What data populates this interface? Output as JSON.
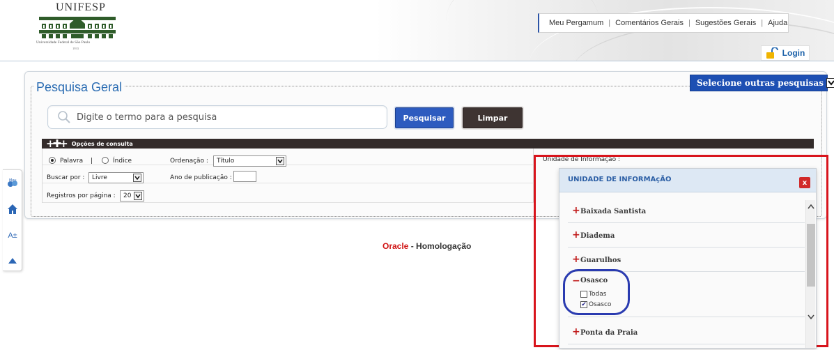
{
  "header": {
    "logo_name": "UNIFESP",
    "logo_university": "Universidade Federal de São Paulo",
    "logo_year": "1933",
    "links": [
      "Meu Pergamum",
      "Comentários Gerais",
      "Sugestões Gerais",
      "Ajuda"
    ],
    "login_label": "Login"
  },
  "main": {
    "title": "Pesquisa Geral",
    "other_searches_label": "Selecione outras pesquisas",
    "search_placeholder": "Digite o termo para a pesquisa",
    "search_button": "Pesquisar",
    "clear_button": "Limpar",
    "options_bar_label": "Opções de consulta",
    "options": {
      "radio_word": "Palavra",
      "radio_separator": "|",
      "radio_index": "Índice",
      "ordering_label": "Ordenação :",
      "ordering_value": "Título",
      "search_by_label": "Buscar por :",
      "search_by_value": "Livre",
      "year_label": "Ano de publicação :",
      "per_page_label": "Registros por página :",
      "per_page_value": "20"
    },
    "unit_label": "Unidade de Informação :"
  },
  "side_toolbar": {
    "items": [
      "meu-pergamum-icon",
      "home-icon",
      "font-size-icon",
      "scroll-top-icon"
    ],
    "font_size_text": "A±"
  },
  "footer": {
    "oracle_red": "Oracle",
    "oracle_rest": " - Homologação"
  },
  "popup": {
    "title": "UNIDADE DE INFORMAçÃO",
    "close_label": "x",
    "units": [
      {
        "name": "Baixada Santista",
        "expanded": false
      },
      {
        "name": "Diadema",
        "expanded": false
      },
      {
        "name": "Guarulhos",
        "expanded": false
      },
      {
        "name": "Osasco",
        "expanded": true
      },
      {
        "name": "Ponta da Praia",
        "expanded": false
      }
    ],
    "osasco_items": [
      {
        "label": "Todas",
        "checked": false
      },
      {
        "label": "Osasco",
        "checked": true
      }
    ]
  },
  "colors": {
    "brand_blue": "#2c6db3",
    "search_button": "#2d5bbf",
    "clear_button": "#3e3432",
    "highlight_red": "#d8141c",
    "highlight_blue": "#2a3bb0"
  }
}
